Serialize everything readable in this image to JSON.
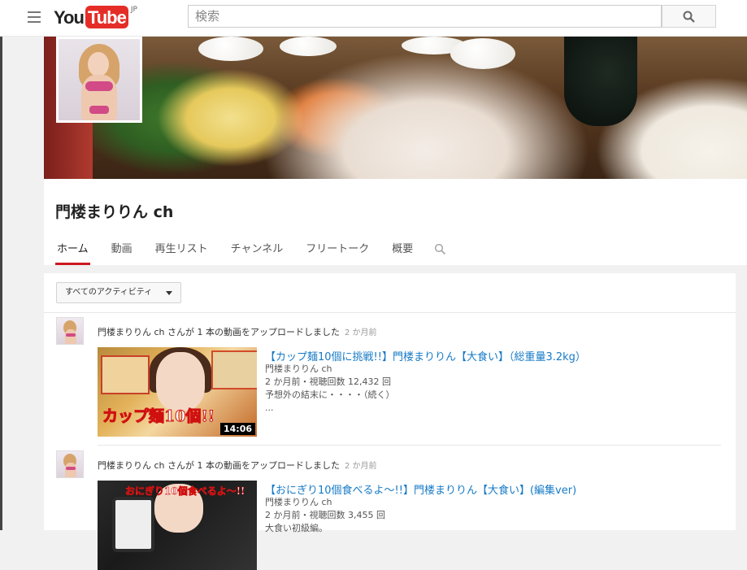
{
  "header": {
    "logo_you": "You",
    "logo_tube": "Tube",
    "logo_region": "JP",
    "search_placeholder": "検索"
  },
  "channel": {
    "title": "門楼まりりん ch",
    "tabs": [
      "ホーム",
      "動画",
      "再生リスト",
      "チャンネル",
      "フリートーク",
      "概要"
    ],
    "active_tab": "ホーム"
  },
  "feed": {
    "filter_label": "すべてのアクティビティ",
    "items": [
      {
        "activity": "門楼まりりん ch さんが 1 本の動画をアップロードしました",
        "time": "2 か月前",
        "video_title": "【カップ麺10個に挑戦!!】門楼まりりん【大食い】（総重量3.2kg）",
        "channel": "門楼まりりん ch",
        "stats": "2 か月前・視聴回数 12,432 回",
        "description": "予想外の結末に・・・・（続く）",
        "more": "...",
        "duration": "14:06",
        "thumb_text": "カップ麺10個!!"
      },
      {
        "activity": "門楼まりりん ch さんが 1 本の動画をアップロードしました",
        "time": "2 か月前",
        "video_title": "【おにぎり10個食べるよ〜!!】門楼まりりん【大食い】(編集ver)",
        "channel": "門楼まりりん ch",
        "stats": "2 か月前・視聴回数 3,455 回",
        "description": "大食い初級編。",
        "thumb_text": "おにぎり10個食べるよ〜!!"
      }
    ]
  },
  "colors": {
    "accent_red": "#cc181e",
    "link_blue": "#167ac6",
    "logo_red": "#e52d27"
  }
}
